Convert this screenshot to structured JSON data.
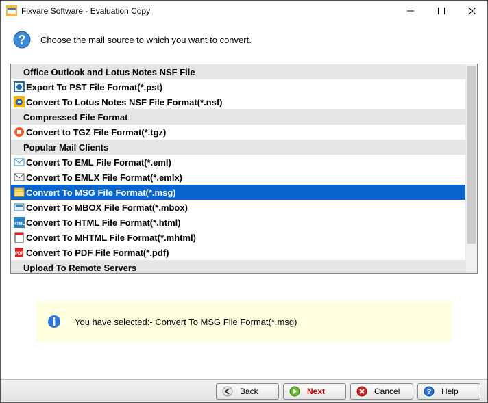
{
  "window": {
    "title": "Fixvare Software - Evaluation Copy"
  },
  "instruction": {
    "text": "Choose the mail source to which you want to convert."
  },
  "list": [
    {
      "type": "header",
      "label": "Office Outlook and Lotus Notes NSF File"
    },
    {
      "type": "item",
      "icon": "pst",
      "label": "Export To PST File Format(*.pst)"
    },
    {
      "type": "item",
      "icon": "nsf",
      "label": "Convert To Lotus Notes NSF File Format(*.nsf)"
    },
    {
      "type": "header",
      "label": "Compressed File Format"
    },
    {
      "type": "item",
      "icon": "tgz",
      "label": "Convert to TGZ File Format(*.tgz)"
    },
    {
      "type": "header",
      "label": "Popular Mail Clients"
    },
    {
      "type": "item",
      "icon": "eml",
      "label": "Convert To EML File Format(*.eml)"
    },
    {
      "type": "item",
      "icon": "emlx",
      "label": "Convert To EMLX File Format(*.emlx)"
    },
    {
      "type": "item",
      "icon": "msg",
      "label": "Convert To MSG File Format(*.msg)",
      "selected": true
    },
    {
      "type": "item",
      "icon": "mbox",
      "label": "Convert To MBOX File Format(*.mbox)"
    },
    {
      "type": "item",
      "icon": "html",
      "label": "Convert To HTML File Format(*.html)"
    },
    {
      "type": "item",
      "icon": "mhtml",
      "label": "Convert To MHTML File Format(*.mhtml)"
    },
    {
      "type": "item",
      "icon": "pdf",
      "label": "Convert To PDF File Format(*.pdf)"
    },
    {
      "type": "header",
      "label": "Upload To Remote Servers"
    }
  ],
  "info": {
    "text": "You have selected:- Convert To MSG File Format(*.msg)"
  },
  "footer": {
    "back": "Back",
    "next": "Next",
    "cancel": "Cancel",
    "help": "Help"
  }
}
